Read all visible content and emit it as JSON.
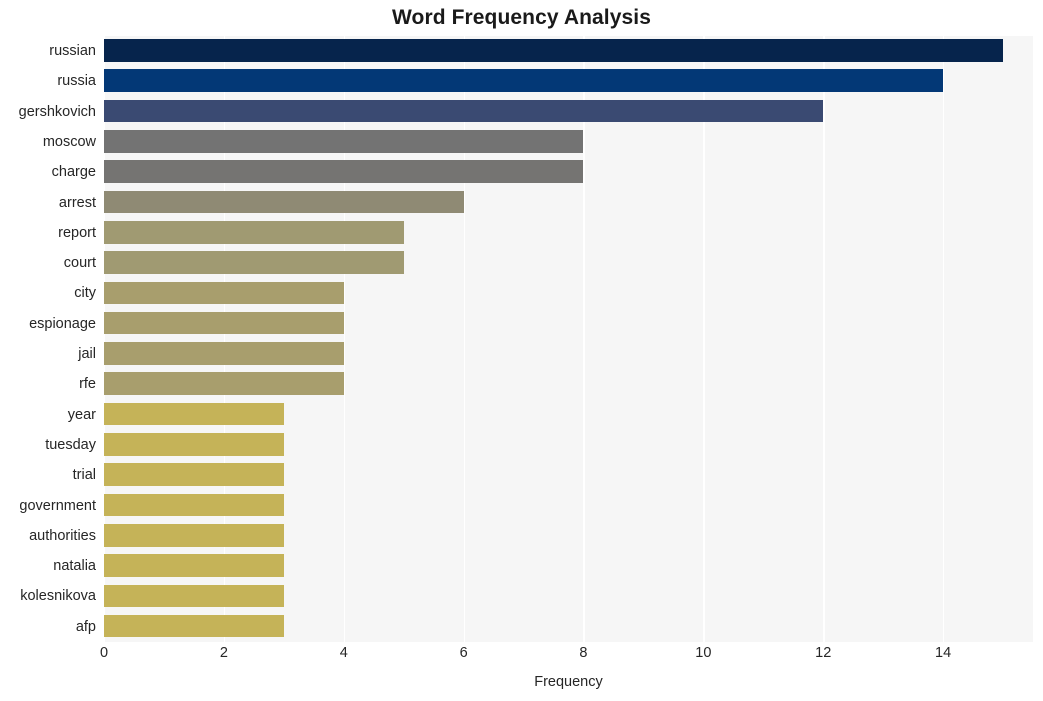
{
  "chart_data": {
    "type": "bar",
    "orientation": "horizontal",
    "title": "Word Frequency Analysis",
    "xlabel": "Frequency",
    "ylabel": "",
    "xlim": [
      0,
      15.5
    ],
    "xticks": [
      0,
      2,
      4,
      6,
      8,
      10,
      12,
      14
    ],
    "xticklabels": [
      "0",
      "2",
      "4",
      "6",
      "8",
      "10",
      "12",
      "14"
    ],
    "grid": "vertical-only",
    "legend": "none",
    "categories": [
      "russian",
      "russia",
      "gershkovich",
      "moscow",
      "charge",
      "arrest",
      "report",
      "court",
      "city",
      "espionage",
      "jail",
      "rfe",
      "year",
      "tuesday",
      "trial",
      "government",
      "authorities",
      "natalia",
      "kolesnikova",
      "afp"
    ],
    "values": [
      15,
      14,
      12,
      8,
      8,
      6,
      5,
      5,
      4,
      4,
      4,
      4,
      3,
      3,
      3,
      3,
      3,
      3,
      3,
      3
    ],
    "bar_colors": [
      "#06244c",
      "#033876",
      "#3a4a72",
      "#737373",
      "#757472",
      "#8f8a74",
      "#a09a72",
      "#a09a72",
      "#a89e6d",
      "#a89e6d",
      "#a89e6d",
      "#a89e6d",
      "#c5b358",
      "#c5b358",
      "#c5b358",
      "#c5b358",
      "#c5b358",
      "#c5b358",
      "#c5b358",
      "#c5b358"
    ]
  },
  "style": {
    "figure_background": "#ffffff",
    "plot_background": "#f6f6f6",
    "gridline_color": "#ffffff",
    "text_color": "#262626",
    "title_color": "#1a1a1a"
  }
}
